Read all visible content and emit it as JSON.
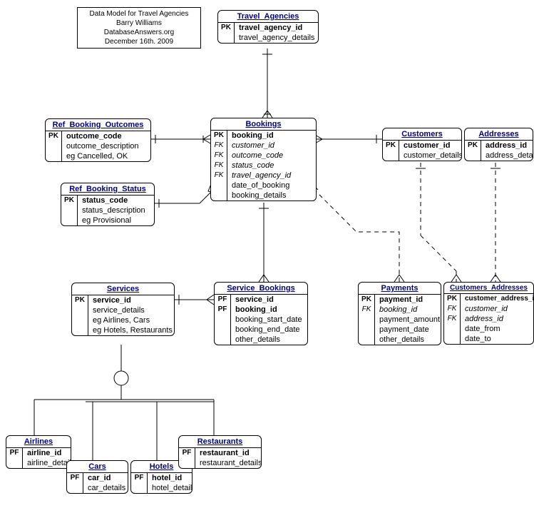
{
  "info": {
    "line1": "Data Model for Travel Agencies",
    "line2": "Barry Williams",
    "line3": "DatabaseAnswers.org",
    "line4": "December 16th. 2009"
  },
  "travel_agencies": {
    "title": "Travel_Agencies",
    "pk": "PK",
    "pk_attr": "travel_agency_id",
    "a1": "travel_agency_details"
  },
  "ref_outcomes": {
    "title": "Ref_Booking_Outcomes",
    "pk": "PK",
    "pk_attr": "outcome_code",
    "a1": "outcome_description",
    "a2": "eg Cancelled, OK"
  },
  "ref_status": {
    "title": "Ref_Booking_Status",
    "pk": "PK",
    "pk_attr": "status_code",
    "a1": "status_description",
    "a2": "eg Provisional"
  },
  "bookings": {
    "title": "Bookings",
    "pk": "PK",
    "pk_attr": "booking_id",
    "fk": "FK",
    "f1": "customer_id",
    "f2": "outcome_code",
    "f3": "status_code",
    "f4": "travel_agency_id",
    "a1": "date_of_booking",
    "a2": "booking_details"
  },
  "customers": {
    "title": "Customers",
    "pk": "PK",
    "pk_attr": "customer_id",
    "a1": "customer_details"
  },
  "addresses": {
    "title": "Addresses",
    "pk": "PK",
    "pk_attr": "address_id",
    "a1": "address_details"
  },
  "services": {
    "title": "Services",
    "pk": "PK",
    "pk_attr": "service_id",
    "a1": "service_details",
    "a2": "eg Airlines, Cars",
    "a3": "eg Hotels, Restaurants"
  },
  "service_bookings": {
    "title": "Service_Bookings",
    "pf": "PF",
    "p1": "service_id",
    "p2": "booking_id",
    "a1": "booking_start_date",
    "a2": "booking_end_date",
    "a3": "other_details"
  },
  "payments": {
    "title": "Payments",
    "pk": "PK",
    "pk_attr": "payment_id",
    "fk": "FK",
    "f1": "booking_id",
    "a1": "payment_amount",
    "a2": "payment_date",
    "a3": "other_details"
  },
  "cust_addr": {
    "title": "Customers_Addresses",
    "pk": "PK",
    "pk_attr": "customer_address_id",
    "fk": "FK",
    "f1": "customer_id",
    "f2": "address_id",
    "a1": "date_from",
    "a2": "date_to"
  },
  "airlines": {
    "title": "Airlines",
    "pf": "PF",
    "p1": "airline_id",
    "a1": "airline_details"
  },
  "cars": {
    "title": "Cars",
    "pf": "PF",
    "p1": "car_id",
    "a1": "car_details"
  },
  "hotels": {
    "title": "Hotels",
    "pf": "PF",
    "p1": "hotel_id",
    "a1": "hotel_details"
  },
  "restaurants": {
    "title": "Restaurants",
    "pf": "PF",
    "p1": "restaurant_id",
    "a1": "restaurant_details"
  }
}
